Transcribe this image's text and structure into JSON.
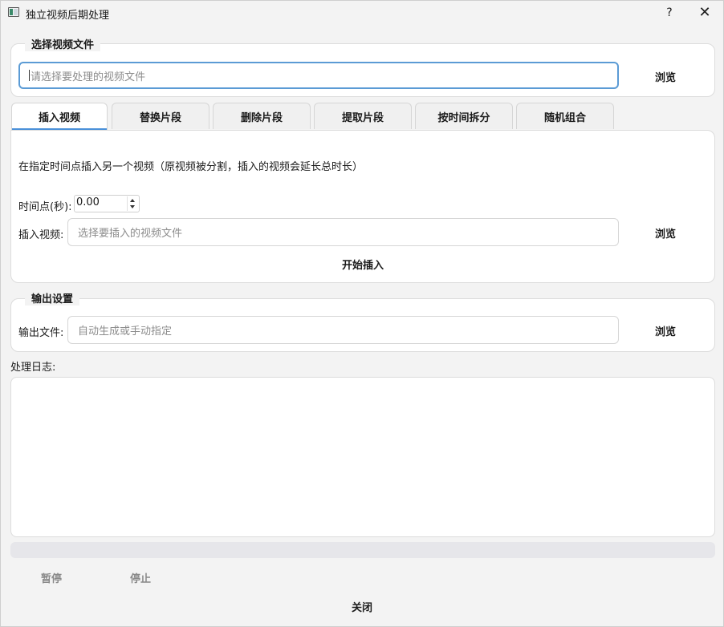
{
  "window": {
    "title": "独立视频后期处理",
    "help": "?",
    "close": "✕"
  },
  "file_group": {
    "title": "选择视频文件",
    "placeholder": "请选择要处理的视频文件",
    "browse": "浏览"
  },
  "tabs": [
    {
      "label": "插入视频",
      "active": true
    },
    {
      "label": "替换片段"
    },
    {
      "label": "删除片段"
    },
    {
      "label": "提取片段"
    },
    {
      "label": "按时间拆分"
    },
    {
      "label": "随机组合"
    }
  ],
  "insert_tab": {
    "description": "在指定时间点插入另一个视频（原视频被分割，插入的视频会延长总时长）",
    "time_label": "时间点(秒):",
    "time_value": "0.00",
    "insert_label": "插入视频:",
    "insert_placeholder": "选择要插入的视频文件",
    "browse": "浏览",
    "start": "开始插入"
  },
  "output_group": {
    "title": "输出设置",
    "label": "输出文件:",
    "placeholder": "自动生成或手动指定",
    "browse": "浏览"
  },
  "log": {
    "label": "处理日志:"
  },
  "progress": {
    "value": 0
  },
  "controls": {
    "pause": "暂停",
    "stop": "停止",
    "close": "关闭"
  }
}
